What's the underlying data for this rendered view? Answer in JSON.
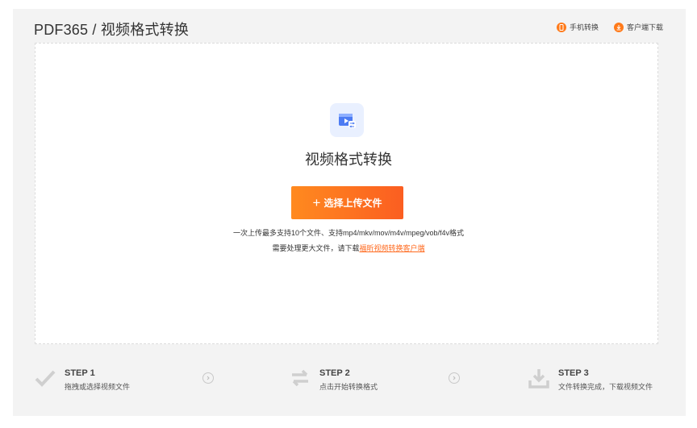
{
  "header": {
    "brand": "PDF365 / 视频格式转换",
    "links": [
      {
        "label": "手机转换",
        "icon": "phone-icon"
      },
      {
        "label": "客户端下载",
        "icon": "download-icon"
      }
    ]
  },
  "main": {
    "tool_icon": "video-convert-icon",
    "tool_title": "视频格式转换",
    "upload_button": {
      "plus": "+",
      "label": "选择上传文件"
    },
    "note_line1": "一次上传最多支持10个文件、支持mp4/mkv/mov/m4v/mpeg/vob/f4v格式",
    "note_line2_prefix": "需要处理更大文件，请下载",
    "note_line2_link": "福昕视频转换客户端"
  },
  "steps": [
    {
      "title": "STEP 1",
      "desc": "拖拽或选择视频文件",
      "icon": "check-icon"
    },
    {
      "title": "STEP 2",
      "desc": "点击开始转换格式",
      "icon": "swap-icon"
    },
    {
      "title": "STEP 3",
      "desc": "文件转换完成，下载视频文件",
      "icon": "download-tray-icon"
    }
  ],
  "colors": {
    "accent": "#ff7a1a",
    "panel": "#f3f3f3",
    "icon_bg": "#e9f0ff",
    "icon_fg": "#4d7cf3"
  }
}
